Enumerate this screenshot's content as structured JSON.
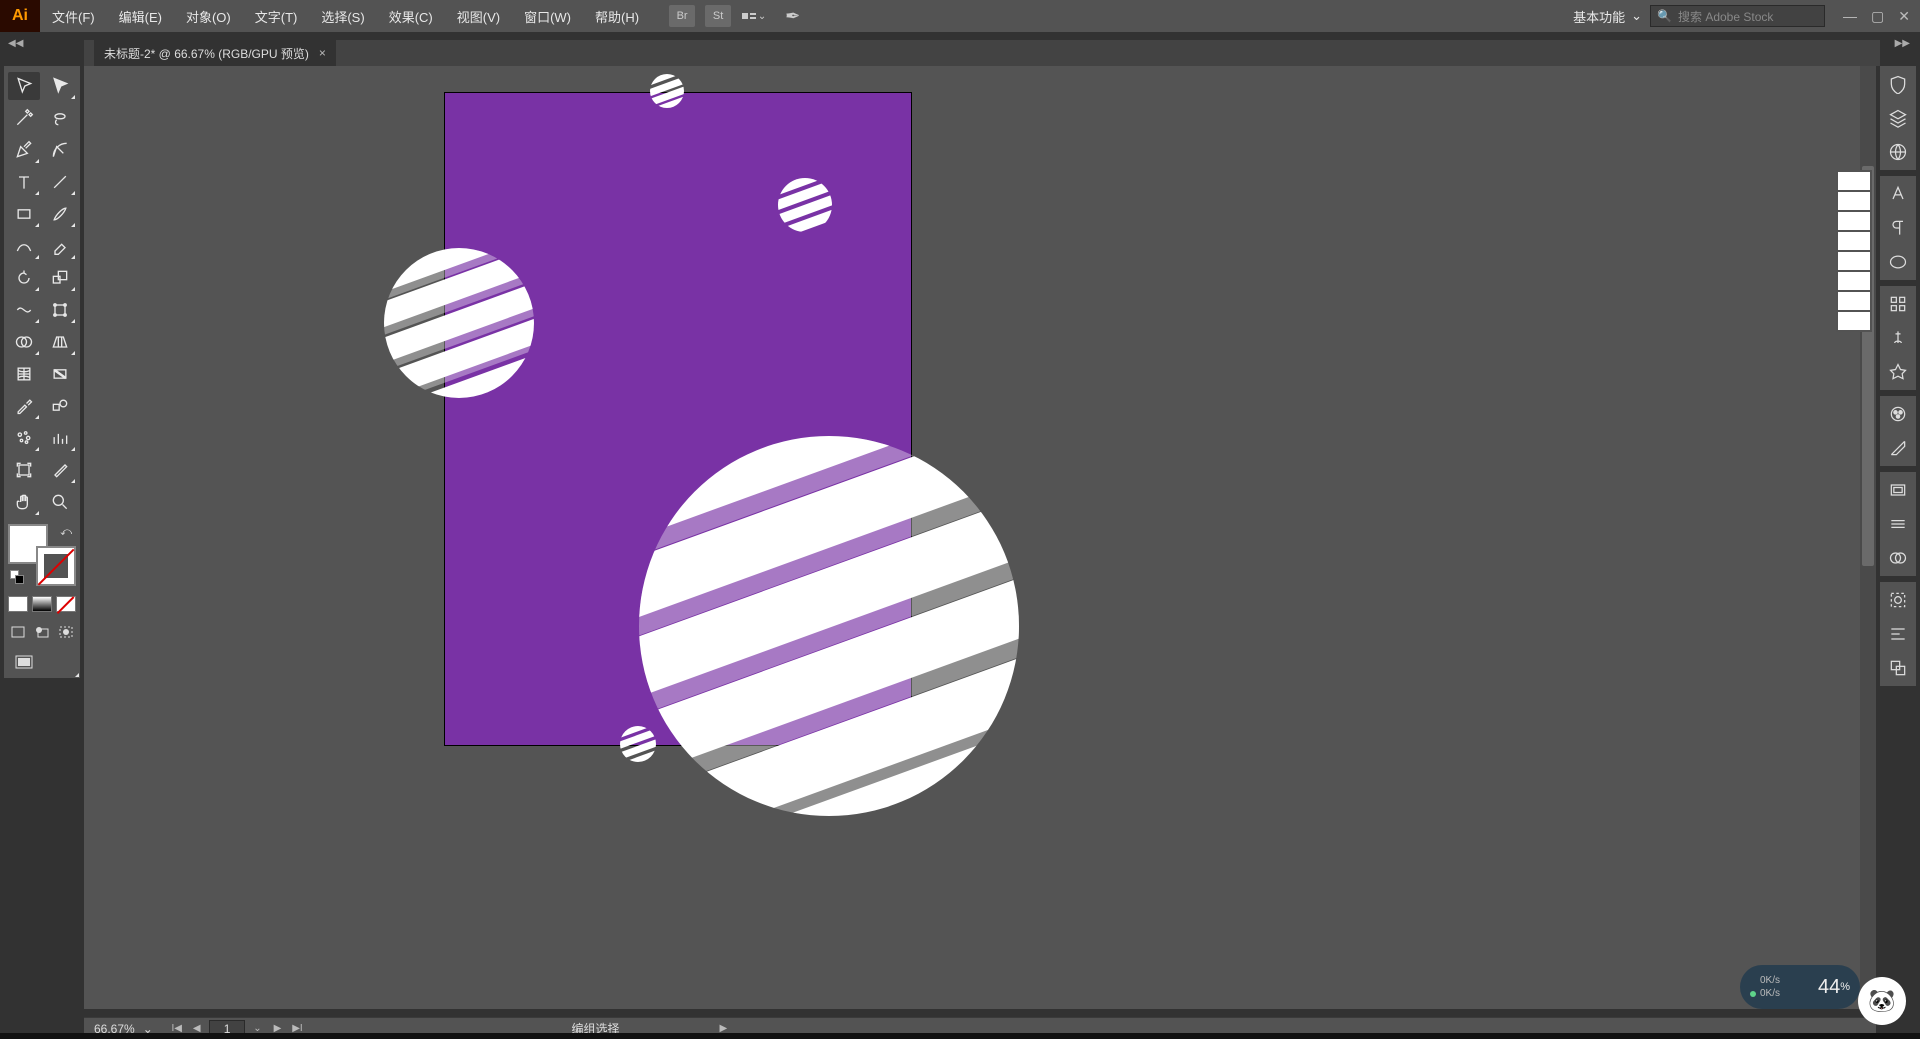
{
  "app": {
    "logo": "Ai"
  },
  "menu": {
    "items": [
      "文件(F)",
      "编辑(E)",
      "对象(O)",
      "文字(T)",
      "选择(S)",
      "效果(C)",
      "视图(V)",
      "窗口(W)",
      "帮助(H)"
    ],
    "iconBr": "Br",
    "iconSt": "St"
  },
  "workspace": {
    "label": "基本功能"
  },
  "search": {
    "placeholder": "搜索 Adobe Stock",
    "icon": "🔍"
  },
  "tab": {
    "title": "未标题-2* @ 66.67% (RGB/GPU 预览)",
    "close": "×"
  },
  "status": {
    "zoom": "66.67%",
    "artboard": "1",
    "selection": "编组选择"
  },
  "badge": {
    "upSpeed": "0K/s",
    "downSpeed": "0K/s",
    "big": "44",
    "pct": "%"
  },
  "canvas": {
    "bgColor": "#7932a5"
  }
}
